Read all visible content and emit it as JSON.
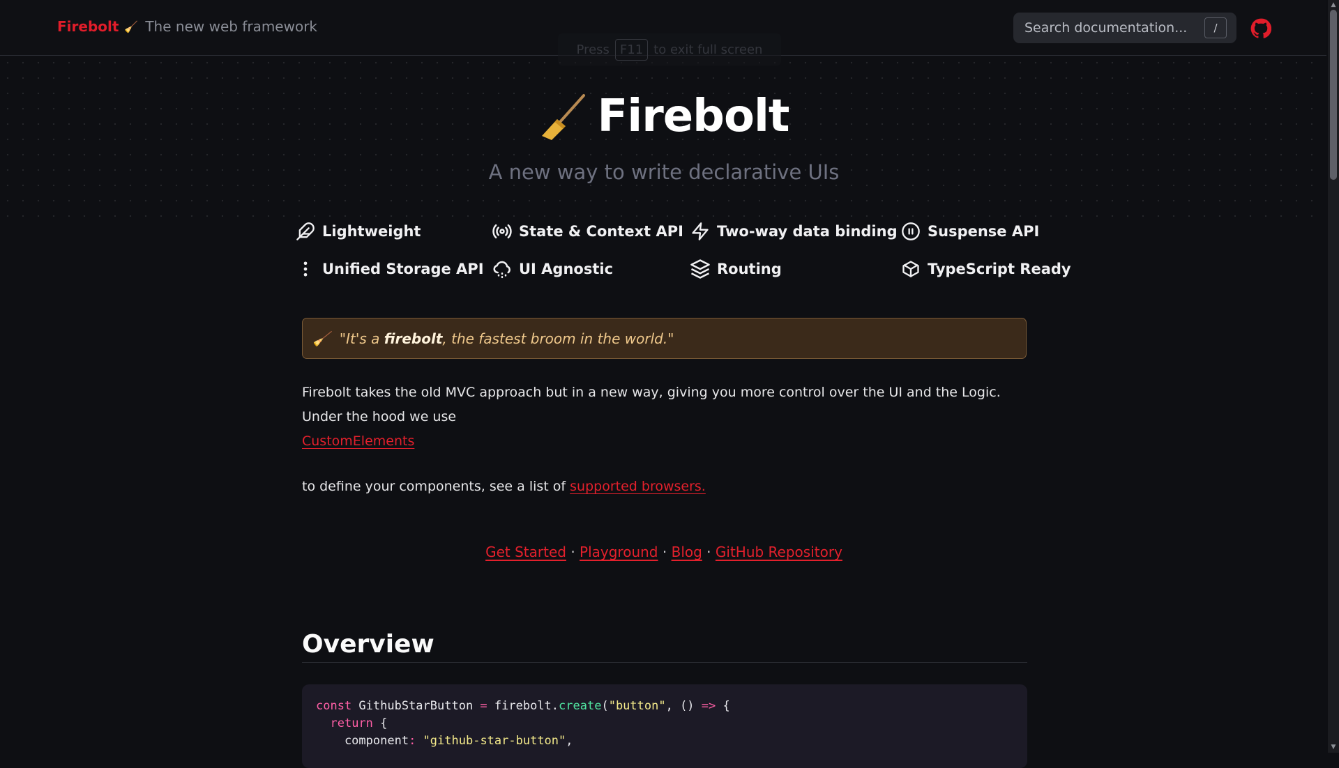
{
  "header": {
    "brand": "Firebolt",
    "brand_emoji": "🧹",
    "tagline": "The new web framework",
    "search_placeholder": "Search documentation...",
    "search_shortcut": "/",
    "github_icon": "github-icon",
    "accent": "#e11d2a"
  },
  "fullscreen_hint": {
    "before": "Press",
    "key": "F11",
    "after": "to exit full screen"
  },
  "hero": {
    "emoji": "🧹",
    "title": "Firebolt",
    "subtitle": "A new way to write declarative UIs"
  },
  "features": [
    {
      "label": "Lightweight",
      "icon": "feather-icon"
    },
    {
      "label": "State & Context API",
      "icon": "broadcast-icon"
    },
    {
      "label": "Two-way data binding",
      "icon": "lightning-icon"
    },
    {
      "label": "Suspense API",
      "icon": "pause-circle-icon"
    },
    {
      "label": "Unified Storage API",
      "icon": "dots-vertical-icon"
    },
    {
      "label": "UI Agnostic",
      "icon": "cloud-icon"
    },
    {
      "label": "Routing",
      "icon": "layers-icon"
    },
    {
      "label": "TypeScript Ready",
      "icon": "package-icon"
    }
  ],
  "quote": {
    "emoji": "🧹",
    "pre": "\"It's a ",
    "bold": "firebolt",
    "post": ", the fastest broom in the world.\""
  },
  "intro": {
    "line1": "Firebolt takes the old MVC approach but in a new way, giving you more control over the UI and the Logic. Under the hood we use",
    "link_custom_elements": "CustomElements",
    "line2_pre": "to define your components, see a list of ",
    "link_supported_browsers": "supported browsers."
  },
  "quick_links": {
    "get_started": "Get Started",
    "playground": "Playground",
    "blog": "Blog",
    "github_repo": "GitHub Repository",
    "separator": "·"
  },
  "overview": {
    "heading": "Overview"
  },
  "code": {
    "l1": [
      "const",
      " GithubStarButton ",
      "=",
      " firebolt.",
      "create",
      "(",
      "\"button\"",
      ", () ",
      "=>",
      " {"
    ],
    "l2": [
      "  ",
      "return",
      " {"
    ],
    "l3": [
      "    component",
      ":",
      " ",
      "\"github-star-button\"",
      ","
    ]
  }
}
